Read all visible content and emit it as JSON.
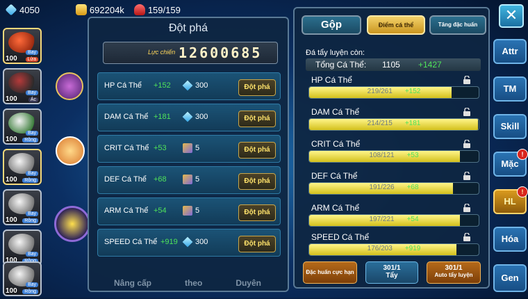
{
  "topbar": {
    "gems": "4050",
    "gold": "692204k",
    "stamina": "159/159"
  },
  "roster": [
    {
      "level": "100",
      "tags": [
        "Bay",
        "Lửa"
      ]
    },
    {
      "level": "100",
      "tags": [
        "Bay",
        "Ác"
      ]
    },
    {
      "level": "100",
      "tags": [
        "Bay",
        "Rồng"
      ]
    },
    {
      "level": "100",
      "tags": [
        "Bay",
        "Rồng"
      ]
    },
    {
      "level": "100",
      "tags": [
        "Bay",
        "Rồng"
      ]
    },
    {
      "level": "100",
      "tags": [
        "Bay",
        "Rồng"
      ]
    },
    {
      "level": "100",
      "tags": [
        "Bay",
        "Rồng"
      ]
    }
  ],
  "breakthrough": {
    "title": "Đột phá",
    "power_label": "Lực chiến",
    "power_value": "12600685",
    "rows": [
      {
        "name": "HP Cá Thể",
        "increase": "+152",
        "cost": "300",
        "cost_icon": "diamond-icon",
        "button": "Đột phá"
      },
      {
        "name": "DAM Cá Thể",
        "increase": "+181",
        "cost": "300",
        "cost_icon": "diamond-icon",
        "button": "Đột phá"
      },
      {
        "name": "CRIT Cá Thể",
        "increase": "+53",
        "cost": "5",
        "cost_icon": "scroll-icon",
        "button": "Đột phá"
      },
      {
        "name": "DEF Cá Thể",
        "increase": "+68",
        "cost": "5",
        "cost_icon": "scroll-icon",
        "button": "Đột phá"
      },
      {
        "name": "ARM Cá Thể",
        "increase": "+54",
        "cost": "5",
        "cost_icon": "scroll-icon",
        "button": "Đột phá"
      },
      {
        "name": "SPEED Cá Thể",
        "increase": "+919",
        "cost": "300",
        "cost_icon": "diamond-icon",
        "button": "Đột phá"
      }
    ]
  },
  "background_tabs": [
    "Nâng cấp",
    "theo",
    "Duyên"
  ],
  "training": {
    "tabs": [
      "Gộp",
      "Điểm cá thể",
      "Tăng đặc huấn"
    ],
    "remaining_label": "Đá tẩy luyện còn:",
    "total_label": "Tổng Cá Thể:",
    "total_value": "1105",
    "total_bonus": "+1427",
    "stats": [
      {
        "name": "HP Cá Thể",
        "value": "219/261",
        "bonus": "+152",
        "fill": 0.84
      },
      {
        "name": "DAM Cá Thể",
        "value": "214/215",
        "bonus": "+181",
        "fill": 0.995
      },
      {
        "name": "CRIT Cá Thể",
        "value": "108/121",
        "bonus": "+53",
        "fill": 0.89
      },
      {
        "name": "DEF Cá Thể",
        "value": "191/226",
        "bonus": "+68",
        "fill": 0.85
      },
      {
        "name": "ARM Cá Thể",
        "value": "197/221",
        "bonus": "+54",
        "fill": 0.89
      },
      {
        "name": "SPEED Cá Thể",
        "value": "176/203",
        "bonus": "+919",
        "fill": 0.87
      }
    ],
    "buttons": {
      "special": "Đặc huấn cực hạn",
      "wash_count": "301/1",
      "wash_label": "Tẩy",
      "auto_count": "301/1",
      "auto_label": "Auto tẩy luyện"
    }
  },
  "right_tabs": [
    {
      "label": "Attr",
      "badge": ""
    },
    {
      "label": "TM",
      "badge": ""
    },
    {
      "label": "Skill",
      "badge": ""
    },
    {
      "label": "Mặc",
      "badge": "!"
    },
    {
      "label": "HL",
      "badge": "!"
    },
    {
      "label": "Hóa",
      "badge": ""
    },
    {
      "label": "Gen",
      "badge": ""
    }
  ],
  "colors": {
    "increase": "#4fe35a",
    "gold_button": "#ffe36b",
    "panel": "#0e2642",
    "active_tab": "#d99a1e"
  }
}
